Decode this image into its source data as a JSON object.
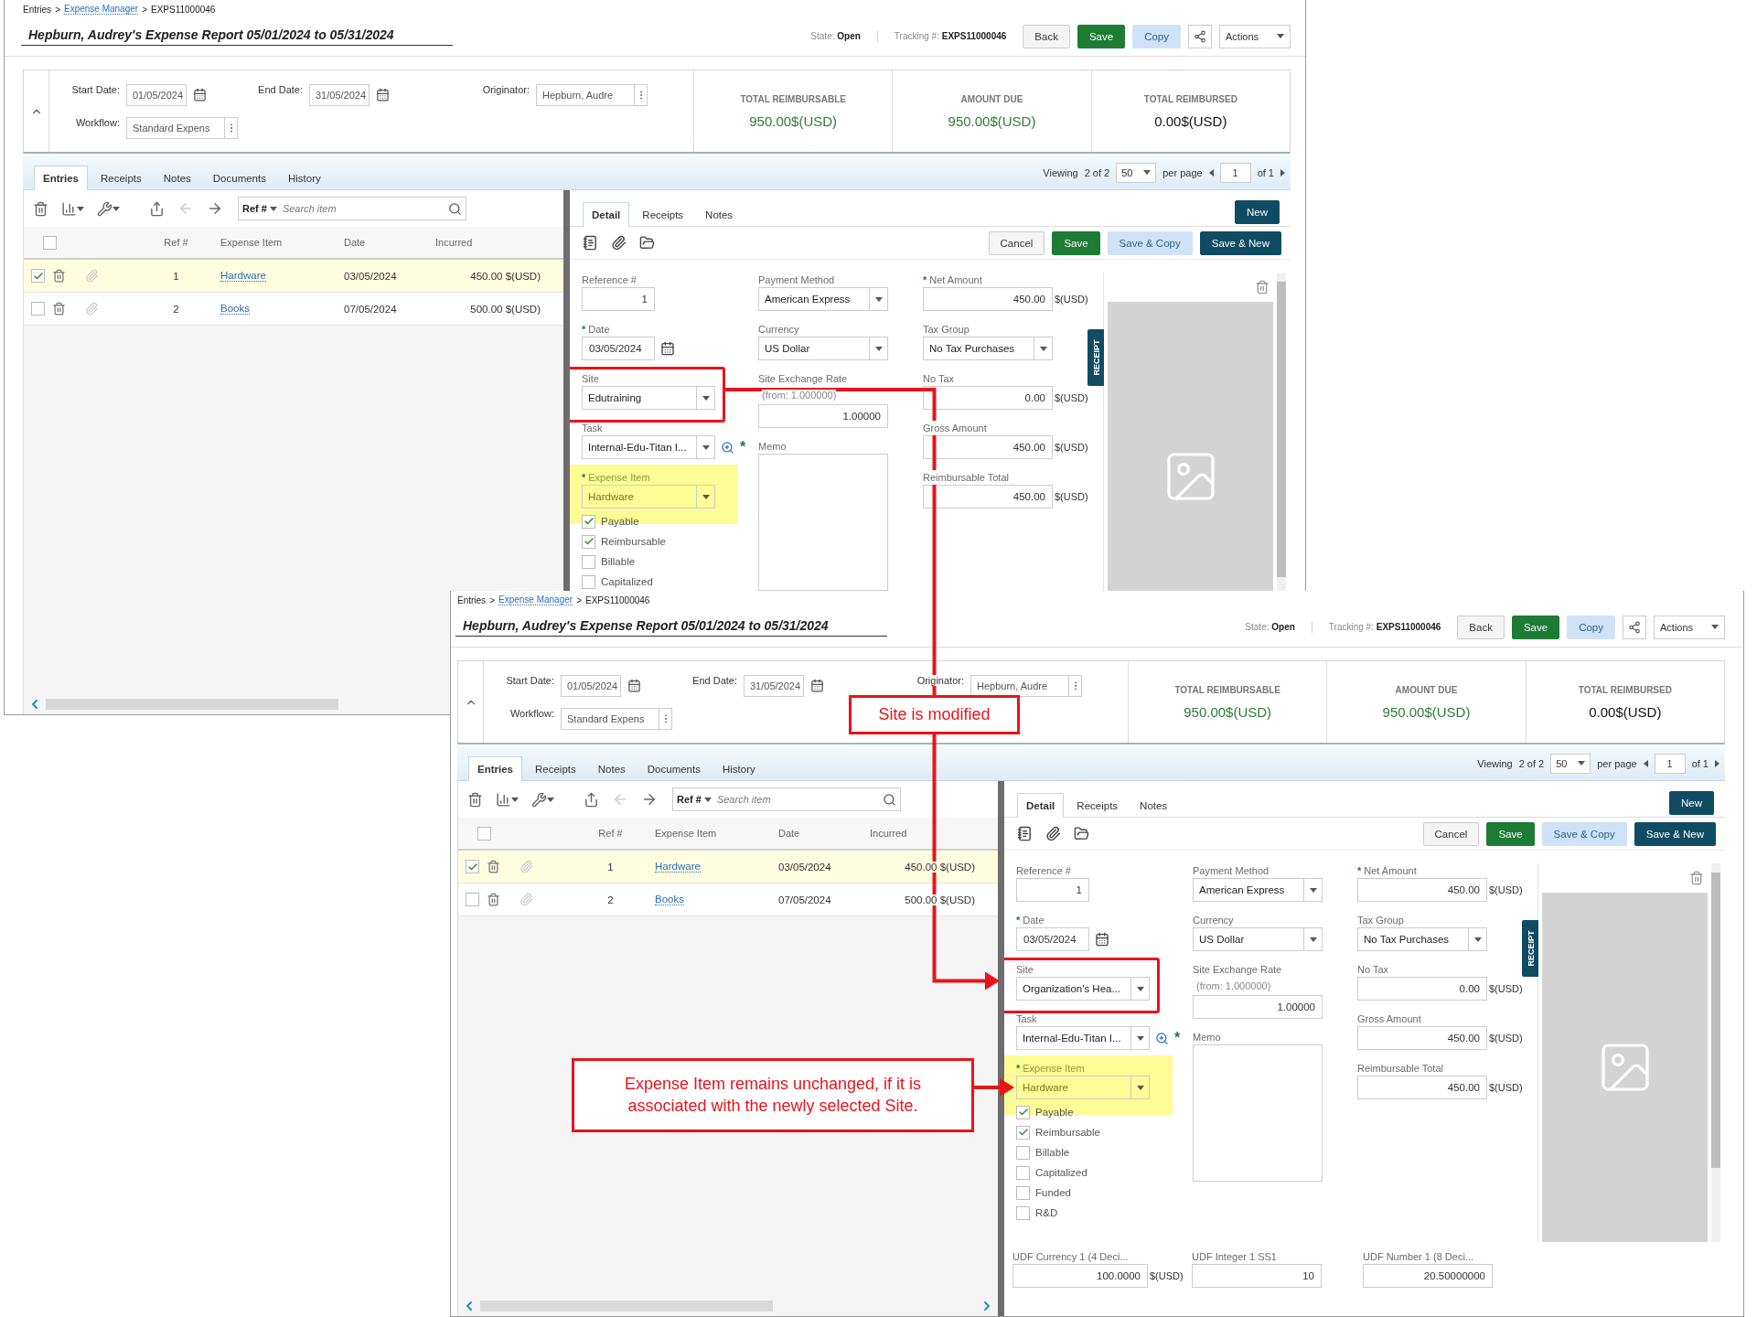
{
  "shots": [
    {
      "breadcrumb": {
        "separator": ">",
        "items": [
          {
            "label": "Entries",
            "link": false
          },
          {
            "label": "Expense Manager",
            "link": true
          },
          {
            "label": "EXPS11000046",
            "link": false
          }
        ]
      },
      "title": "Hepburn, Audrey's Expense Report 05/01/2024 to 05/31/2024",
      "state": {
        "label": "State:",
        "value": "Open"
      },
      "tracking": {
        "label": "Tracking #:",
        "value": "EXPS11000046"
      },
      "actions": [
        {
          "kind": "default",
          "label": "Back"
        },
        {
          "kind": "primary",
          "label": "Save"
        },
        {
          "kind": "secondary",
          "label": "Copy"
        },
        {
          "kind": "share"
        },
        {
          "kind": "menu",
          "label": "Actions"
        }
      ],
      "filters": [
        {
          "kind": "date",
          "label": "Start Date:",
          "value": "01/05/2024"
        },
        {
          "kind": "date",
          "label": "End Date:",
          "value": "31/05/2024"
        },
        {
          "kind": "lookup",
          "label": "Originator:",
          "value": "Hepburn, Audre"
        },
        {
          "kind": "lookup",
          "label": "Workflow:",
          "value": "Standard Expens"
        }
      ],
      "totals": [
        {
          "label": "TOTAL REIMBURSABLE",
          "value": "950.00$(USD)",
          "color": "#2e7d32"
        },
        {
          "label": "AMOUNT DUE",
          "value": "950.00$(USD)",
          "color": "#2e7d32"
        },
        {
          "label": "TOTAL REIMBURSED",
          "value": "0.00$(USD)",
          "color": "#111111"
        }
      ],
      "tabs": [
        {
          "label": "Entries",
          "selected": true
        },
        {
          "label": "Receipts",
          "selected": false
        },
        {
          "label": "Notes",
          "selected": false
        },
        {
          "label": "Documents",
          "selected": false
        },
        {
          "label": "History",
          "selected": false
        }
      ],
      "pager": {
        "viewing": "Viewing",
        "count": "2 of 2",
        "page_size": "50",
        "per_page": "per page",
        "page": "1",
        "of": "of 1"
      },
      "list": {
        "search_scope": "Ref #",
        "search_placeholder": "Search item",
        "all_checked": false,
        "columns": [
          "Ref #",
          "Expense Item",
          "Date",
          "Incurred"
        ],
        "rows": [
          {
            "selected": true,
            "checked": true,
            "ref": "1",
            "item": "Hardware",
            "date": "03/05/2024",
            "incurred": "450.00 $(USD)"
          },
          {
            "selected": false,
            "checked": false,
            "ref": "2",
            "item": "Books",
            "date": "07/05/2024",
            "incurred": "500.00 $(USD)"
          }
        ]
      },
      "detail": {
        "tabs": [
          {
            "label": "Detail",
            "selected": true
          },
          {
            "label": "Receipts",
            "selected": false
          },
          {
            "label": "Notes",
            "selected": false
          }
        ],
        "new_button": "New",
        "actions": [
          {
            "kind": "default",
            "label": "Cancel"
          },
          {
            "kind": "primary",
            "label": "Save"
          },
          {
            "kind": "secondary",
            "label": "Save & Copy"
          },
          {
            "kind": "dark",
            "label": "Save & New"
          }
        ],
        "columns": [
          [
            {
              "kind": "number",
              "label": "Reference #",
              "value": "1",
              "framed": false,
              "highlighted": false
            },
            {
              "kind": "date",
              "label": "Date",
              "marker": "*",
              "value": "03/05/2024",
              "framed": false,
              "highlighted": false
            },
            {
              "kind": "select",
              "label": "Site",
              "value": "Edutraining",
              "framed": true,
              "highlighted": false
            },
            {
              "kind": "lookup",
              "label": "Task",
              "value": "Internal-Edu-Titan I...",
              "marker": "*",
              "framed": false,
              "highlighted": false
            },
            {
              "kind": "select",
              "label": "Expense Item",
              "marker": "*",
              "value": "Hardware",
              "framed": false,
              "highlighted": true
            }
          ],
          [
            {
              "kind": "select",
              "label": "Payment Method",
              "value": "American Express"
            },
            {
              "kind": "select",
              "label": "Currency",
              "value": "US Dollar"
            },
            {
              "kind": "rate",
              "label": "Site Exchange Rate",
              "note": "(from: 1.000000)",
              "value": "1.00000"
            },
            {
              "kind": "memo",
              "label": "Memo"
            }
          ],
          [
            {
              "kind": "amount",
              "label": "Net Amount",
              "marker": "*",
              "value": "450.00",
              "unit": "$(USD)"
            },
            {
              "kind": "select",
              "label": "Tax Group",
              "value": "No Tax Purchases"
            },
            {
              "kind": "amount",
              "label": "No Tax",
              "value": "0.00",
              "unit": "$(USD)"
            },
            {
              "kind": "amount",
              "label": "Gross Amount",
              "value": "450.00",
              "unit": "$(USD)"
            },
            {
              "kind": "amount",
              "label": "Reimbursable Total",
              "value": "450.00",
              "unit": "$(USD)"
            }
          ]
        ],
        "checkboxes": [
          {
            "label": "Payable",
            "checked": true
          },
          {
            "label": "Reimbursable",
            "checked": true
          },
          {
            "label": "Billable",
            "checked": false
          },
          {
            "label": "Capitalized",
            "checked": false
          }
        ],
        "receipt_tab": "RECEIPT"
      }
    },
    {
      "breadcrumb": {
        "separator": ">",
        "items": [
          {
            "label": "Entries",
            "link": false
          },
          {
            "label": "Expense Manager",
            "link": true
          },
          {
            "label": "EXPS11000046",
            "link": false
          }
        ]
      },
      "title": "Hepburn, Audrey's Expense Report 05/01/2024 to 05/31/2024",
      "state": {
        "label": "State:",
        "value": "Open"
      },
      "tracking": {
        "label": "Tracking #:",
        "value": "EXPS11000046"
      },
      "actions": [
        {
          "kind": "default",
          "label": "Back"
        },
        {
          "kind": "primary",
          "label": "Save"
        },
        {
          "kind": "secondary",
          "label": "Copy"
        },
        {
          "kind": "share"
        },
        {
          "kind": "menu",
          "label": "Actions"
        }
      ],
      "filters": [
        {
          "kind": "date",
          "label": "Start Date:",
          "value": "01/05/2024"
        },
        {
          "kind": "date",
          "label": "End Date:",
          "value": "31/05/2024"
        },
        {
          "kind": "lookup",
          "label": "Originator:",
          "value": "Hepburn, Audre"
        },
        {
          "kind": "lookup",
          "label": "Workflow:",
          "value": "Standard Expens"
        }
      ],
      "totals": [
        {
          "label": "TOTAL REIMBURSABLE",
          "value": "950.00$(USD)",
          "color": "#2e7d32"
        },
        {
          "label": "AMOUNT DUE",
          "value": "950.00$(USD)",
          "color": "#2e7d32"
        },
        {
          "label": "TOTAL REIMBURSED",
          "value": "0.00$(USD)",
          "color": "#111111"
        }
      ],
      "tabs": [
        {
          "label": "Entries",
          "selected": true
        },
        {
          "label": "Receipts",
          "selected": false
        },
        {
          "label": "Notes",
          "selected": false
        },
        {
          "label": "Documents",
          "selected": false
        },
        {
          "label": "History",
          "selected": false
        }
      ],
      "pager": {
        "viewing": "Viewing",
        "count": "2 of 2",
        "page_size": "50",
        "per_page": "per page",
        "page": "1",
        "of": "of 1"
      },
      "list": {
        "search_scope": "Ref #",
        "search_placeholder": "Search item",
        "all_checked": false,
        "columns": [
          "Ref #",
          "Expense Item",
          "Date",
          "Incurred"
        ],
        "rows": [
          {
            "selected": true,
            "checked": true,
            "ref": "1",
            "item": "Hardware",
            "date": "03/05/2024",
            "incurred": "450.00 $(USD)"
          },
          {
            "selected": false,
            "checked": false,
            "ref": "2",
            "item": "Books",
            "date": "07/05/2024",
            "incurred": "500.00 $(USD)"
          }
        ]
      },
      "detail": {
        "tabs": [
          {
            "label": "Detail",
            "selected": true
          },
          {
            "label": "Receipts",
            "selected": false
          },
          {
            "label": "Notes",
            "selected": false
          }
        ],
        "new_button": "New",
        "actions": [
          {
            "kind": "default",
            "label": "Cancel"
          },
          {
            "kind": "primary",
            "label": "Save"
          },
          {
            "kind": "secondary",
            "label": "Save & Copy"
          },
          {
            "kind": "dark",
            "label": "Save & New"
          }
        ],
        "columns": [
          [
            {
              "kind": "number",
              "label": "Reference #",
              "value": "1",
              "framed": false,
              "highlighted": false
            },
            {
              "kind": "date",
              "label": "Date",
              "marker": "*",
              "value": "03/05/2024",
              "framed": false,
              "highlighted": false
            },
            {
              "kind": "select",
              "label": "Site",
              "value": "Organization's Hea...",
              "framed": true,
              "highlighted": false
            },
            {
              "kind": "lookup",
              "label": "Task",
              "value": "Internal-Edu-Titan I...",
              "marker": "*",
              "framed": false,
              "highlighted": false
            },
            {
              "kind": "select",
              "label": "Expense Item",
              "marker": "*",
              "value": "Hardware",
              "framed": false,
              "highlighted": true
            }
          ],
          [
            {
              "kind": "select",
              "label": "Payment Method",
              "value": "American Express"
            },
            {
              "kind": "select",
              "label": "Currency",
              "value": "US Dollar"
            },
            {
              "kind": "rate",
              "label": "Site Exchange Rate",
              "note": "(from: 1.000000)",
              "value": "1.00000"
            },
            {
              "kind": "memo",
              "label": "Memo"
            }
          ],
          [
            {
              "kind": "amount",
              "label": "Net Amount",
              "marker": "*",
              "value": "450.00",
              "unit": "$(USD)"
            },
            {
              "kind": "select",
              "label": "Tax Group",
              "value": "No Tax Purchases"
            },
            {
              "kind": "amount",
              "label": "No Tax",
              "value": "0.00",
              "unit": "$(USD)"
            },
            {
              "kind": "amount",
              "label": "Gross Amount",
              "value": "450.00",
              "unit": "$(USD)"
            },
            {
              "kind": "amount",
              "label": "Reimbursable Total",
              "value": "450.00",
              "unit": "$(USD)"
            }
          ]
        ],
        "checkboxes": [
          {
            "label": "Payable",
            "checked": true
          },
          {
            "label": "Reimbursable",
            "checked": true
          },
          {
            "label": "Billable",
            "checked": false
          },
          {
            "label": "Capitalized",
            "checked": false
          },
          {
            "label": "Funded",
            "checked": false
          },
          {
            "label": "R&D",
            "checked": false
          }
        ],
        "receipt_tab": "RECEIPT",
        "udf": [
          {
            "label": "UDF Currency 1 (4 Deci...",
            "value": "100.0000",
            "unit": "$(USD)"
          },
          {
            "label": "UDF Integer 1 SS1",
            "value": "10"
          },
          {
            "label": "UDF Number 1 (8 Deci...",
            "value": "20.50000000"
          }
        ]
      }
    }
  ],
  "callouts": [
    {
      "text": "Site is modified"
    },
    {
      "text": "Expense Item remains unchanged, if it is associated with the newly selected Site."
    }
  ]
}
